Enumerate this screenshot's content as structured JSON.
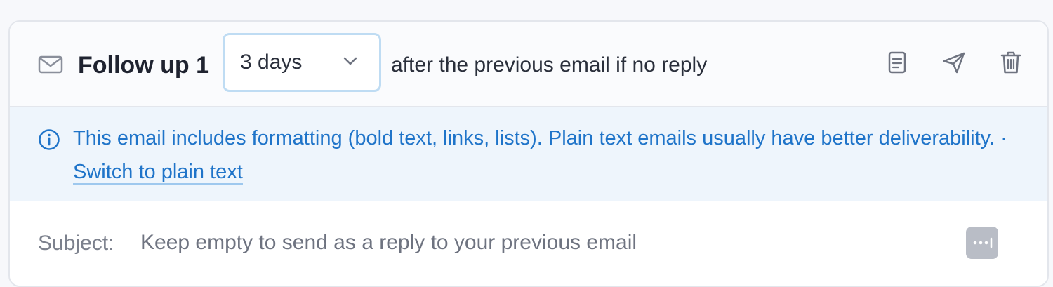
{
  "followup": {
    "title": "Follow up 1",
    "delay_value": "3 days",
    "after_text": "after the previous email if no reply",
    "icons": {
      "mail": "envelope-icon",
      "template": "document-icon",
      "send": "paper-plane-icon",
      "delete": "trash-icon",
      "dropdown": "chevron-down-icon",
      "info": "info-circle-icon",
      "variables": "more-dots-icon"
    }
  },
  "notice": {
    "message": "This email includes formatting (bold text, links, lists). Plain text emails usually have better deliverability.",
    "separator": " · ",
    "link_label": "Switch to plain text"
  },
  "subject": {
    "label": "Subject:",
    "placeholder": "Keep empty to send as a reply to your previous email",
    "value": ""
  },
  "colors": {
    "accent": "#1f74c9",
    "notice_bg": "#eef5fc",
    "select_border": "#bfdcf3"
  }
}
